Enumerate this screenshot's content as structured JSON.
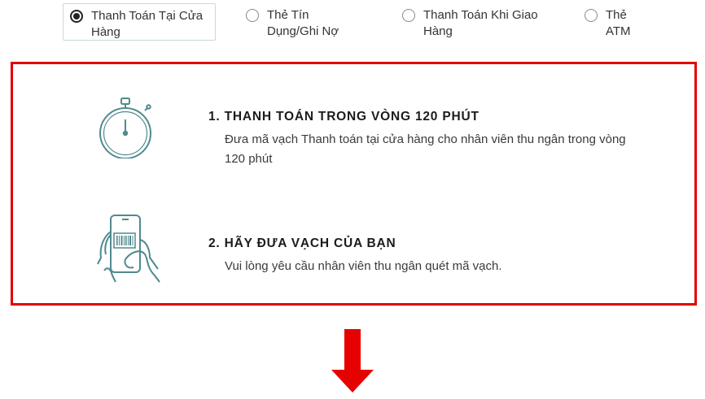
{
  "payment_options": [
    {
      "label": "Thanh Toán Tại Cửa Hàng",
      "selected": true
    },
    {
      "label": "Thẻ Tín Dụng/Ghi Nợ",
      "selected": false
    },
    {
      "label": "Thanh Toán Khi Giao Hàng",
      "selected": false
    },
    {
      "label": "Thẻ ATM",
      "selected": false
    }
  ],
  "steps": [
    {
      "title": "1. Thanh toán trong vòng 120 phút",
      "description": "Đưa mã vạch Thanh toán tại cửa hàng cho nhân viên thu ngân trong vòng 120 phút",
      "icon": "stopwatch-icon"
    },
    {
      "title": "2. Hãy đưa vạch của bạn",
      "description": "Vui lòng yêu cầu nhân viên thu ngân quét mã vạch.",
      "icon": "phone-barcode-icon"
    }
  ],
  "colors": {
    "highlight_border": "#e10000",
    "arrow": "#e60000",
    "icon_teal": "#4f8a8e",
    "radio_selected": "#222222"
  }
}
